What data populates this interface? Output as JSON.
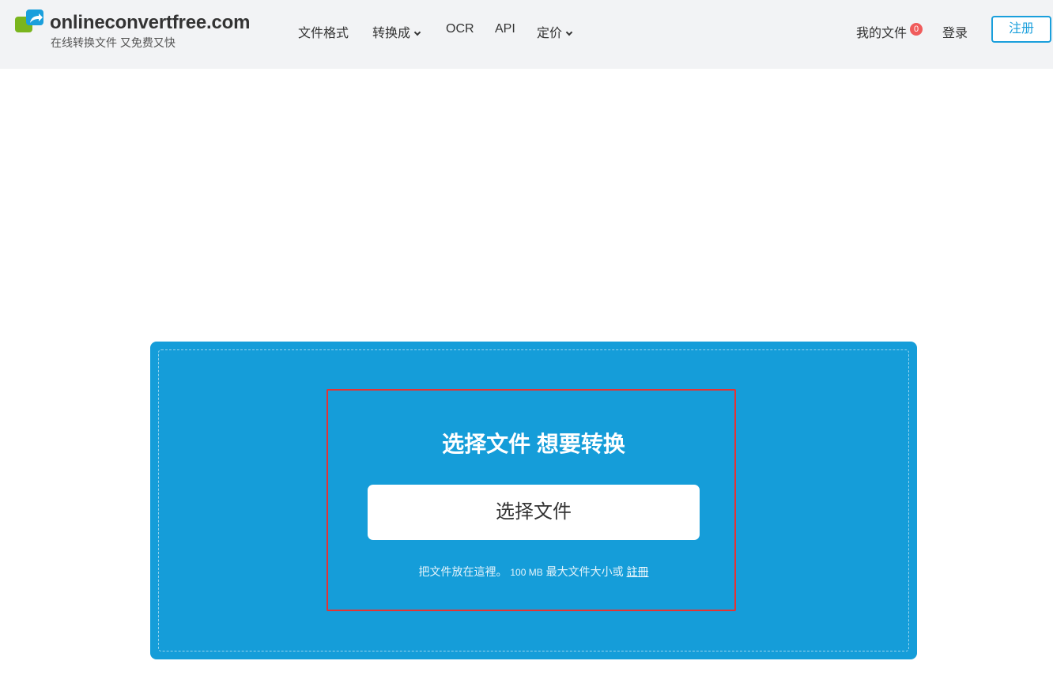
{
  "brand": {
    "name": "onlineconvertfree.com",
    "tagline": "在线转换文件 又免费又快"
  },
  "nav": {
    "file_formats": "文件格式",
    "convert_to": "转换成",
    "ocr": "OCR",
    "api": "API",
    "pricing": "定价"
  },
  "account": {
    "my_files": "我的文件",
    "file_count": "0",
    "login": "登录",
    "register": "注册"
  },
  "upload": {
    "heading": "选择文件 想要转换",
    "button_label": "选择文件",
    "note_prefix": "把文件放在這裡。",
    "note_size": "100 MB",
    "note_middle": "最大文件大小或",
    "note_link": "註冊"
  },
  "colors": {
    "accent": "#159dd9",
    "header_bg": "#f2f3f5",
    "badge": "#f05b5b",
    "highlight_border": "#e53333"
  }
}
